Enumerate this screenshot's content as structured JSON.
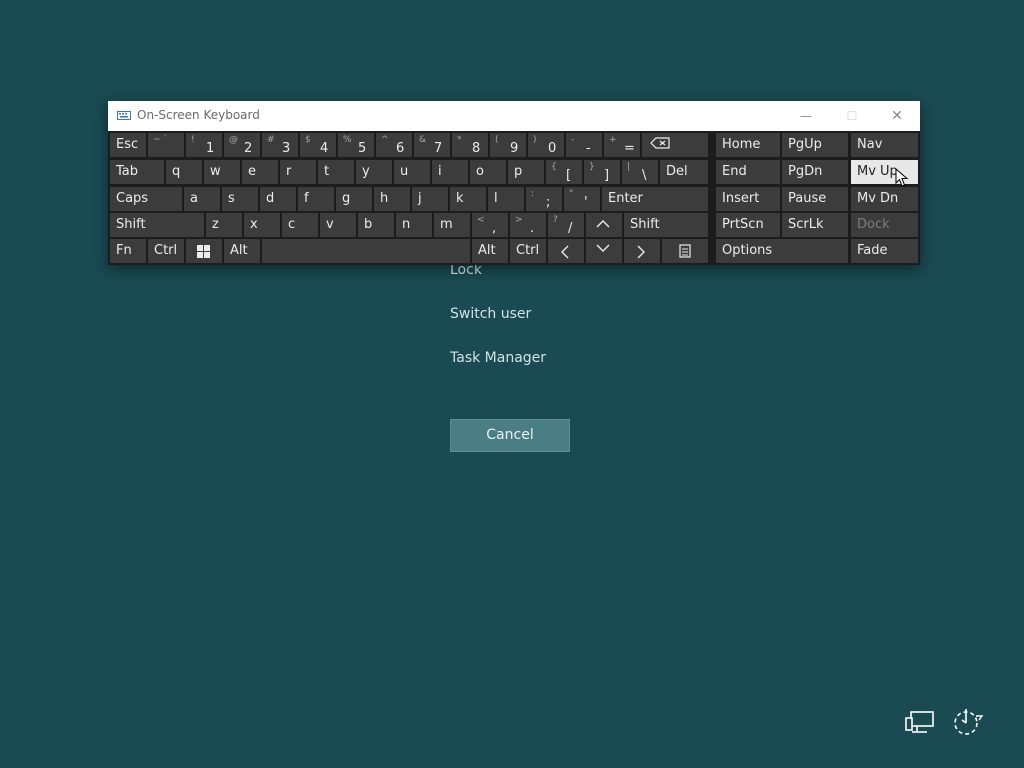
{
  "osk": {
    "title": "On-Screen Keyboard",
    "minimize": "—",
    "maximize": "☐",
    "close": "✕",
    "keys": {
      "esc": "Esc",
      "tilde": {
        "shift": "~ `",
        "main": ""
      },
      "n1": {
        "shift": "!",
        "main": "1"
      },
      "n2": {
        "shift": "@",
        "main": "2"
      },
      "n3": {
        "shift": "#",
        "main": "3"
      },
      "n4": {
        "shift": "$",
        "main": "4"
      },
      "n5": {
        "shift": "%",
        "main": "5"
      },
      "n6": {
        "shift": "^",
        "main": "6"
      },
      "n7": {
        "shift": "&",
        "main": "7"
      },
      "n8": {
        "shift": "*",
        "main": "8"
      },
      "n9": {
        "shift": "(",
        "main": "9"
      },
      "n0": {
        "shift": ")",
        "main": "0"
      },
      "minus": {
        "shift": "-",
        "main": "-"
      },
      "equals": {
        "shift": "+",
        "main": "="
      },
      "tab": "Tab",
      "q": "q",
      "w": "w",
      "e": "e",
      "r": "r",
      "t": "t",
      "y": "y",
      "u": "u",
      "i": "i",
      "o": "o",
      "p": "p",
      "lbracket": {
        "shift": "{",
        "main": "["
      },
      "rbracket": {
        "shift": "}",
        "main": "]"
      },
      "backslash": {
        "shift": "|",
        "main": "\\"
      },
      "del": "Del",
      "caps": "Caps",
      "a": "a",
      "s": "s",
      "d": "d",
      "f": "f",
      "g": "g",
      "h": "h",
      "j": "j",
      "k": "k",
      "l": "l",
      "semicolon": {
        "shift": ":",
        "main": ";"
      },
      "quote": {
        "shift": "\"",
        "main": "'"
      },
      "enter": "Enter",
      "lshift": "Shift",
      "z": "z",
      "x": "x",
      "c": "c",
      "v": "v",
      "b": "b",
      "n": "n",
      "m": "m",
      "comma": {
        "shift": "<",
        "main": ","
      },
      "period": {
        "shift": ">",
        "main": "."
      },
      "slash": {
        "shift": "?",
        "main": "/"
      },
      "rshift": "Shift",
      "fn": "Fn",
      "lctrl": "Ctrl",
      "lalt": "Alt",
      "ralt": "Alt",
      "rctrl": "Ctrl",
      "home": "Home",
      "pgup": "PgUp",
      "nav": "Nav",
      "end": "End",
      "pgdn": "PgDn",
      "mvup": "Mv Up",
      "insert": "Insert",
      "pause": "Pause",
      "mvdn": "Mv Dn",
      "prtscn": "PrtScn",
      "scrlk": "ScrLk",
      "dock": "Dock",
      "options": "Options",
      "fade": "Fade"
    }
  },
  "menu": {
    "lock": "Lock",
    "switch_user": "Switch user",
    "task_manager": "Task Manager",
    "cancel": "Cancel"
  },
  "colors": {
    "background": "#1a4a52",
    "key": "#3c3c3c",
    "key_highlight": "#e8e8e8",
    "cancel_button": "#4a7d84"
  }
}
